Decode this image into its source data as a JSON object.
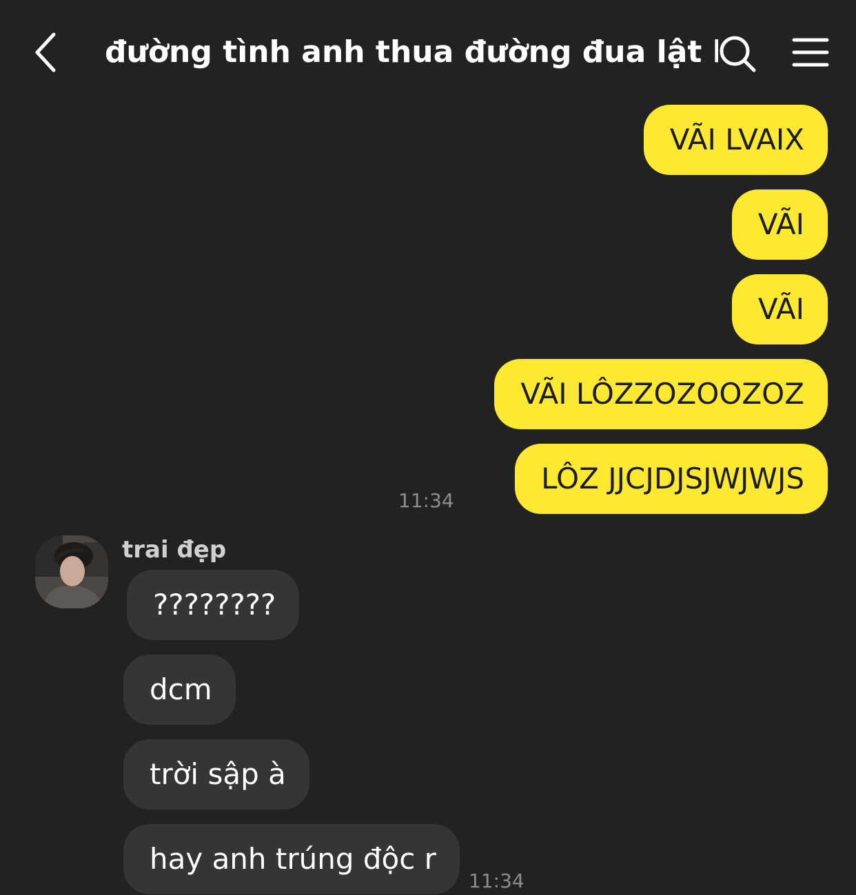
{
  "header": {
    "title": "đường tình anh thua đường đua lật bánh",
    "back_icon": "chevron-left-icon",
    "search_icon": "search-icon",
    "menu_icon": "hamburger-menu-icon"
  },
  "colors": {
    "background": "#222222",
    "my_bubble": "#fee932",
    "their_bubble": "#353535",
    "timestamp": "#8e8e8e"
  },
  "sent": {
    "messages": [
      "VÃI LVAIX",
      "VÃI",
      "VÃI",
      "VÃI LÔZZOZOOZOZ",
      "LÔZ JJCJDJSJWJWJS"
    ],
    "time": "11:34"
  },
  "received": {
    "sender": "trai đẹp",
    "messages": [
      "????????",
      "dcm",
      "trời sập à",
      "hay anh trúng độc r"
    ],
    "time": "11:34"
  }
}
